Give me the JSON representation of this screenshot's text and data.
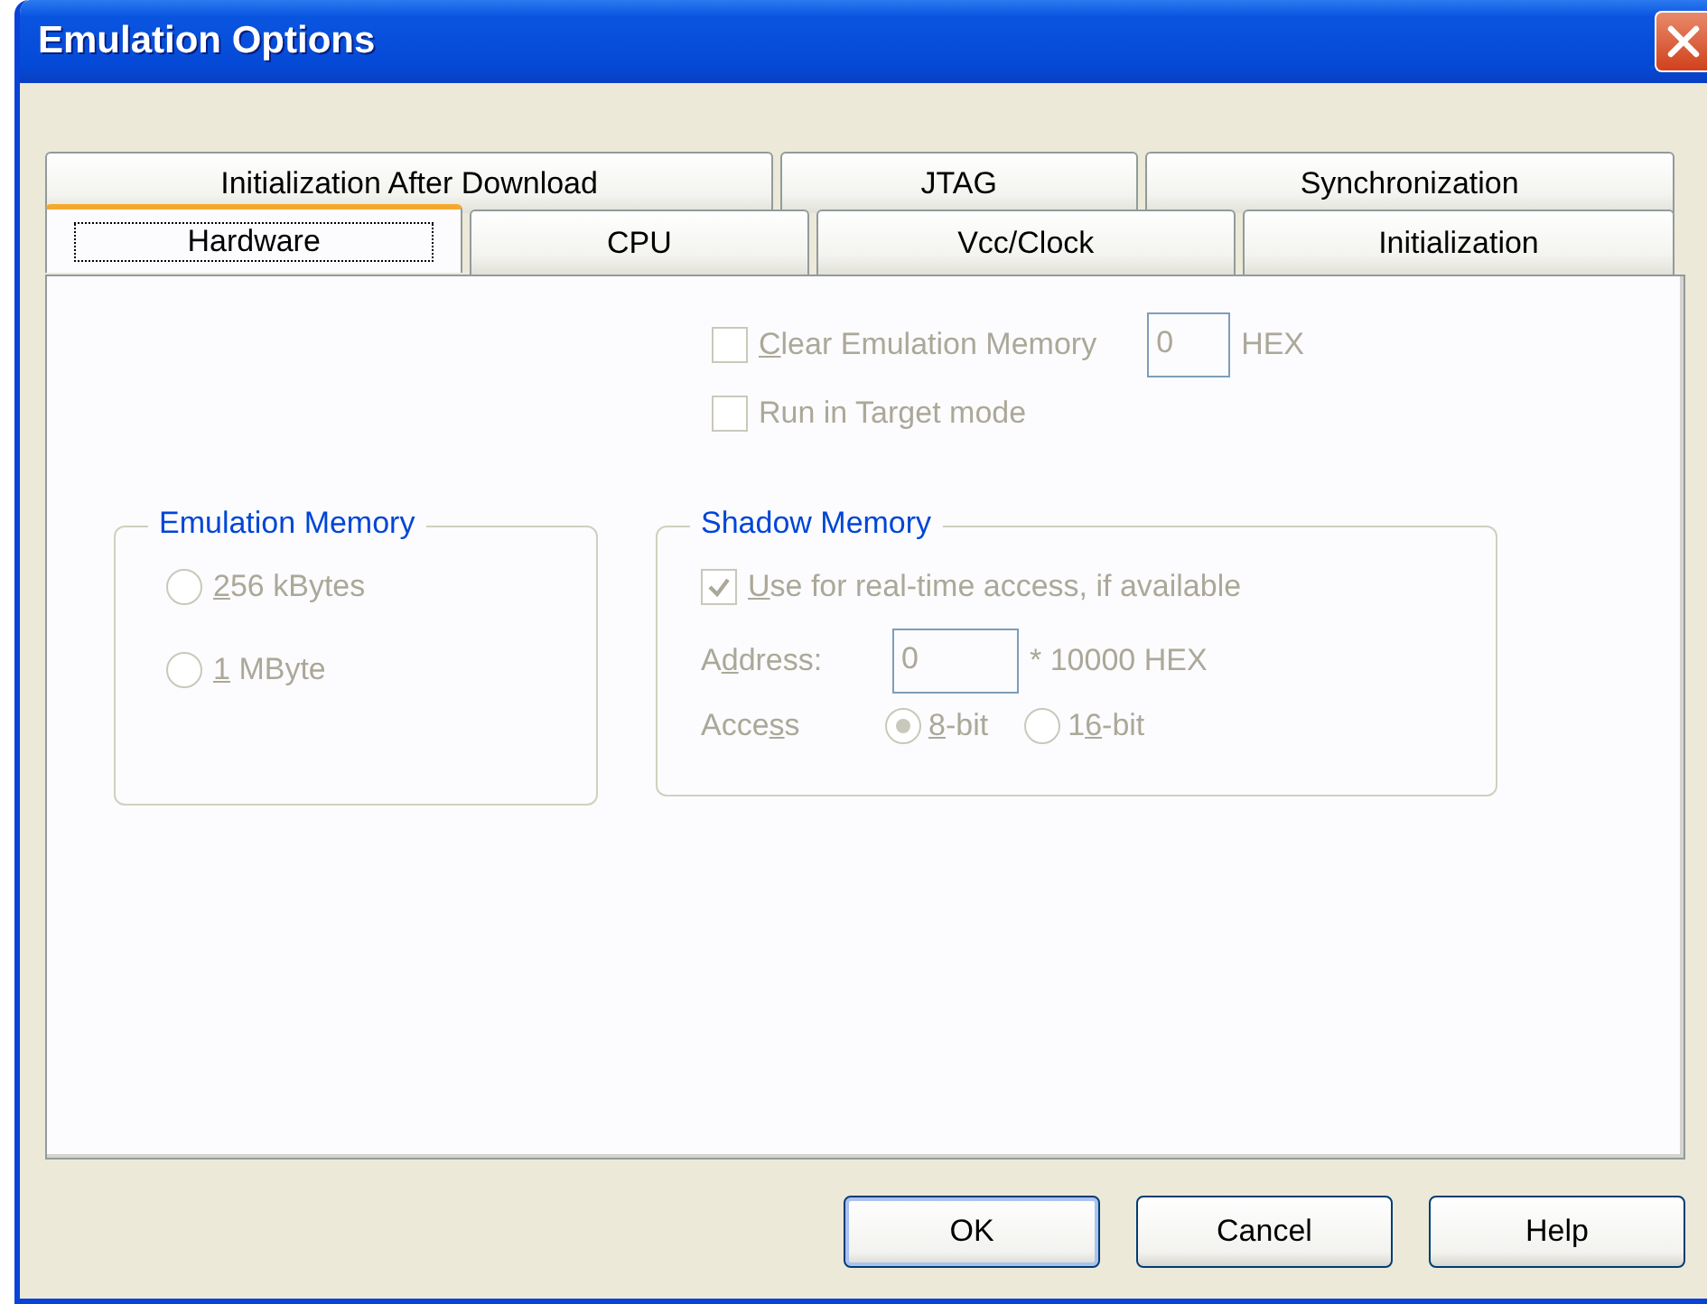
{
  "window": {
    "title": "Emulation Options"
  },
  "tab_rows": [
    {
      "tabs": [
        {
          "label": "Initialization After Download",
          "selected": false
        },
        {
          "label": "JTAG",
          "selected": false
        },
        {
          "label": "Synchronization",
          "selected": false
        }
      ]
    },
    {
      "tabs": [
        {
          "label": "Hardware",
          "selected": true
        },
        {
          "label": "CPU",
          "selected": false
        },
        {
          "label": "Vcc/Clock",
          "selected": false
        },
        {
          "label": "Initialization",
          "selected": false
        }
      ]
    }
  ],
  "hardware": {
    "clear_memory": {
      "label": {
        "key": "C",
        "post": "lear Emulation Memory"
      },
      "checked": false,
      "disabled": true
    },
    "clear_value": "0",
    "clear_unit": "HEX",
    "run_in_target": {
      "label": {
        "pre": "Run in Target mode"
      },
      "checked": false,
      "disabled": true
    },
    "emulation_memory": {
      "title": "Emulation Memory",
      "options": [
        {
          "label": {
            "key": "2",
            "post": "56 kBytes"
          },
          "selected": false,
          "disabled": true
        },
        {
          "label": {
            "key": "1",
            "post": " MByte"
          },
          "selected": false,
          "disabled": true
        }
      ]
    },
    "shadow_memory": {
      "title": "Shadow Memory",
      "use_realtime": {
        "label": {
          "key": "U",
          "post": "se for real-time access, if available"
        },
        "checked": true,
        "disabled": true
      },
      "address_label": {
        "pre": "A",
        "key": "d",
        "post": "dress:"
      },
      "address_value": "0",
      "address_unit": "* 10000 HEX",
      "access_label": {
        "pre": "Acce",
        "key": "s",
        "post": "s"
      },
      "access_options": [
        {
          "label": {
            "key": "8",
            "post": "-bit"
          },
          "selected": true,
          "disabled": true
        },
        {
          "label": {
            "pre": "1",
            "key": "6",
            "post": "-bit"
          },
          "selected": false,
          "disabled": true
        }
      ]
    }
  },
  "buttons": [
    {
      "label": "OK",
      "default": true
    },
    {
      "label": "Cancel",
      "default": false
    },
    {
      "label": "Help",
      "default": false
    }
  ]
}
